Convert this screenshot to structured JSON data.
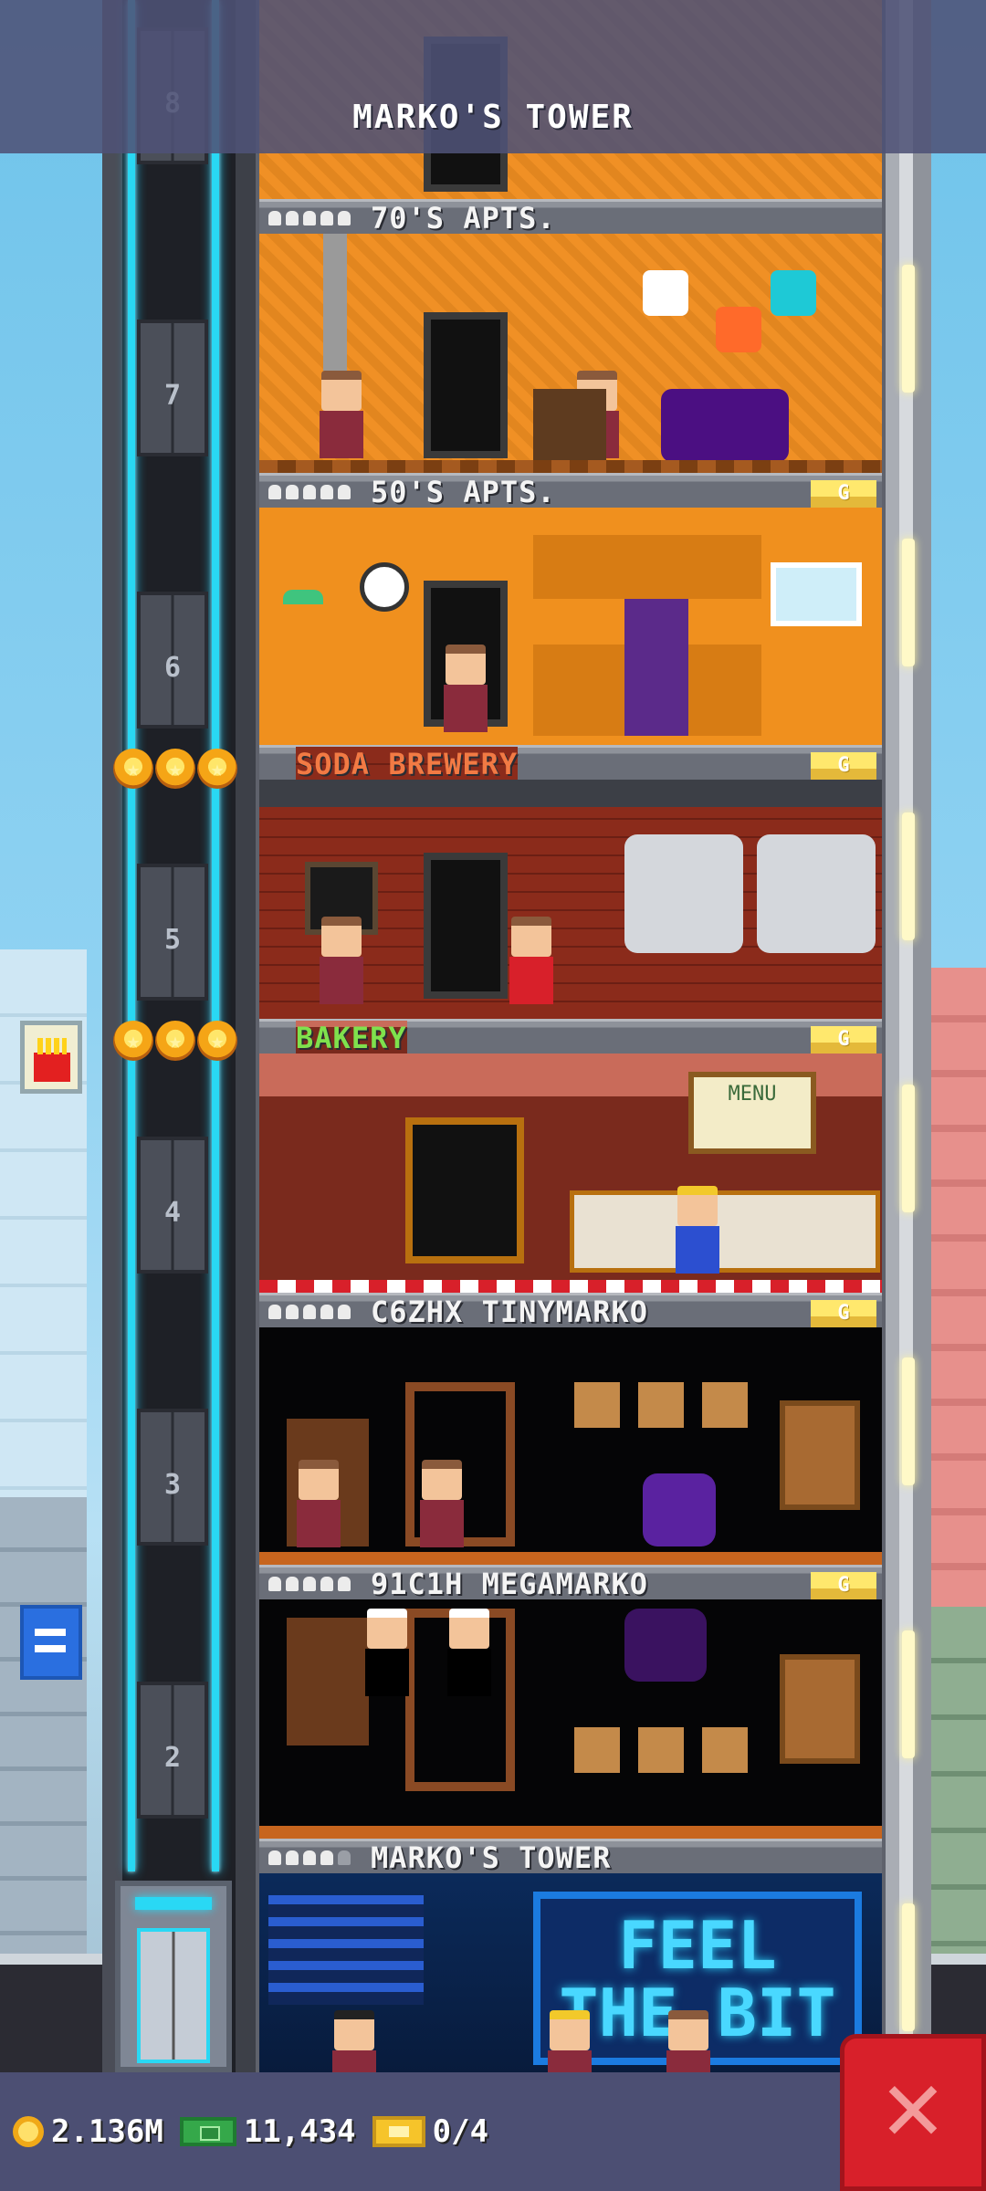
{
  "header": {
    "title": "MARKO'S TOWER"
  },
  "elevator": {
    "floors": [
      {
        "num": "8"
      },
      {
        "num": "7"
      },
      {
        "num": "6"
      },
      {
        "num": "5"
      },
      {
        "num": "4"
      },
      {
        "num": "3"
      },
      {
        "num": "2"
      }
    ]
  },
  "floors": [
    {
      "label": "70'S APTS.",
      "pips_filled": 5,
      "pips_total": 5,
      "gold_tag": ""
    },
    {
      "label": "50'S APTS.",
      "pips_filled": 5,
      "pips_total": 5,
      "gold_tag": "G"
    },
    {
      "label": "SODA BREWERY",
      "gold_tag": "G",
      "stars": 3,
      "label_color": "#f27a44"
    },
    {
      "label": "BAKERY",
      "gold_tag": "G",
      "stars": 3,
      "label_color": "#7fe14d"
    },
    {
      "label": "C6ZHX TINYMARKO",
      "pips_filled": 5,
      "pips_total": 5,
      "gold_tag": "G"
    },
    {
      "label": "91C1H MEGAMARKO",
      "pips_filled": 5,
      "pips_total": 5,
      "gold_tag": "G"
    },
    {
      "label": "MARKO'S TOWER",
      "pips_filled": 4,
      "pips_total": 5,
      "gold_tag": ""
    }
  ],
  "lobby": {
    "sign_text": "FEEL THE BIT"
  },
  "bakery_menu": {
    "text": "MENU"
  },
  "status_bar": {
    "coins": "2.136M",
    "bux": "11,434",
    "tickets": "0/4",
    "coin_icon": "coin-icon",
    "bux_icon": "bux-icon",
    "ticket_icon": "ticket-icon"
  },
  "close_button": {
    "icon": "close-icon"
  }
}
